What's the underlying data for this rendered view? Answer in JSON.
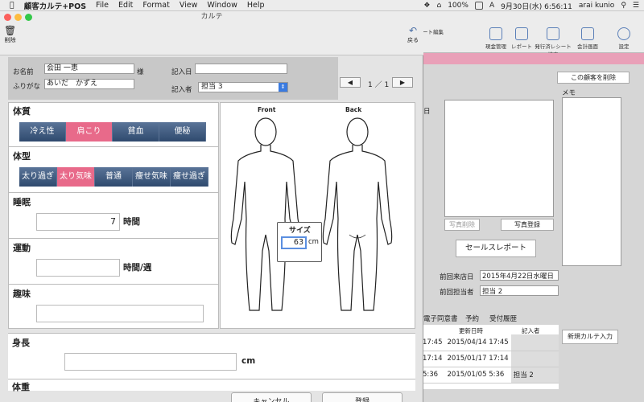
{
  "menubar": {
    "app": "顧客カルテ+POS",
    "items": [
      "File",
      "Edit",
      "Format",
      "View",
      "Window",
      "Help"
    ],
    "battery": "100%",
    "date": "9月30日(水) 6:56:11",
    "user": "arai kunio"
  },
  "bgwin": {
    "toolbar": [
      {
        "label": "ート編集"
      },
      {
        "label": "現金管理"
      },
      {
        "label": "レポート"
      },
      {
        "label": "発行済レシート検索"
      },
      {
        "label": "会計画面"
      },
      {
        "label": "設定"
      }
    ],
    "delete_customer": "この顧客を削除",
    "memo_label": "メモ",
    "photo_delete": "写真削除",
    "photo_register": "写真登録",
    "sales_report": "セールスレポート",
    "last_visit_label": "前回来店日",
    "last_visit": "2015年4月22日水曜日",
    "last_staff_label": "前回担当者",
    "last_staff": "担当 2",
    "side_char": "日",
    "tabs": [
      "電子同意書",
      "予約",
      "受付履歴"
    ],
    "table_headers": [
      "更新日時",
      "記入者"
    ],
    "rows": [
      {
        "left": "17:45",
        "date": "2015/04/14 17:45",
        "by": ""
      },
      {
        "left": "17:14",
        "date": "2015/01/17 17:14",
        "by": ""
      },
      {
        "left": "5:36",
        "date": "2015/01/05 5:36",
        "by": "担当 2"
      }
    ],
    "new_karte": "新規カルテ入力"
  },
  "window": {
    "title": "カルテ",
    "delete_label": "削除",
    "back_label": "戻る"
  },
  "header": {
    "name_label": "お名前",
    "name": "会田 一恵",
    "honorific": "様",
    "furigana_label": "ふりがな",
    "furigana": "あいだ　かずえ",
    "date_label": "記入日",
    "date": "",
    "writer_label": "記入者",
    "writer": "担当 3",
    "page": "1 ／ 1",
    "prev": "◀",
    "next": "▶"
  },
  "sections": {
    "constitution": {
      "title": "体質",
      "options": [
        "冷え性",
        "肩こり",
        "貧血",
        "便秘"
      ],
      "selected": "肩こり"
    },
    "bodytype": {
      "title": "体型",
      "options": [
        "太り過ぎ",
        "太り気味",
        "普通",
        "痩せ気味",
        "痩せ過ぎ"
      ],
      "selected": "太り気味"
    },
    "sleep": {
      "title": "睡眠",
      "value": "7",
      "unit": "時間"
    },
    "exercise": {
      "title": "運動",
      "value": "",
      "unit": "時間/週"
    },
    "hobby": {
      "title": "趣味",
      "value": ""
    },
    "height": {
      "title": "身長",
      "value": "",
      "unit": "cm"
    },
    "weight": {
      "title": "体重"
    }
  },
  "body": {
    "front": "Front",
    "back": "Back",
    "size_title": "サイズ",
    "size_value": "63",
    "size_unit": "cm"
  },
  "footer": {
    "cancel": "キャンセル",
    "register": "登録"
  }
}
